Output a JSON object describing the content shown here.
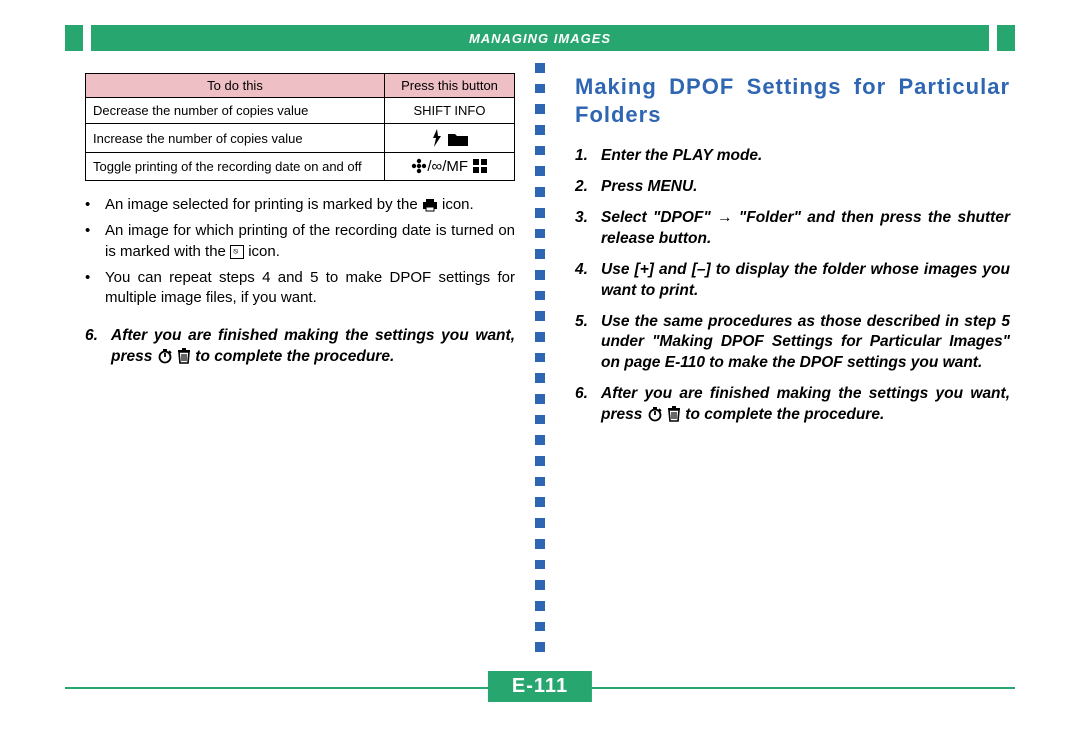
{
  "header": {
    "title": "MANAGING IMAGES"
  },
  "pageNumber": "E-111",
  "left": {
    "table": {
      "headers": [
        "To do this",
        "Press this button"
      ],
      "rows": [
        {
          "action": "Decrease the number of copies value",
          "button": "SHIFT INFO",
          "buttonIconSet": "text"
        },
        {
          "action": "Increase the number of copies value",
          "button": "",
          "buttonIconSet": "flash-folder"
        },
        {
          "action": "Toggle printing of the recording date on and off",
          "button": "",
          "buttonIconSet": "flower-mf-grid"
        }
      ]
    },
    "notes": [
      {
        "pre": "An image selected for printing is marked by the ",
        "icon": "printer-mini",
        "post": " icon."
      },
      {
        "pre": "An image for which printing of the recording date is turned on is marked with the ",
        "icon": "date-box",
        "post": " icon."
      },
      {
        "pre": "You can repeat steps 4 and 5 to make DPOF settings for multiple image files, if you want.",
        "icon": null,
        "post": ""
      }
    ],
    "steps": [
      {
        "num": "6.",
        "pre": "After you are finished making the settings you want, press ",
        "icons": [
          "timer",
          "trash"
        ],
        "post": " to complete the procedure."
      }
    ]
  },
  "right": {
    "title": "Making DPOF Settings for Particular Folders",
    "steps": [
      {
        "num": "1.",
        "text": "Enter the PLAY mode."
      },
      {
        "num": "2.",
        "text": "Press MENU."
      },
      {
        "num": "3.",
        "text": "Select \"DPOF\" → \"Folder\" and then press the shutter release button."
      },
      {
        "num": "4.",
        "text": "Use [+] and [–] to display the folder whose images you want to print."
      },
      {
        "num": "5.",
        "text": "Use the same procedures as those described in step 5 under \"Making DPOF Settings for Particular Images\" on page E-110 to make the DPOF settings you want."
      },
      {
        "num": "6.",
        "pre": "After you are finished making the settings you want, press ",
        "icons": [
          "timer",
          "trash"
        ],
        "post": " to complete the procedure."
      }
    ]
  }
}
